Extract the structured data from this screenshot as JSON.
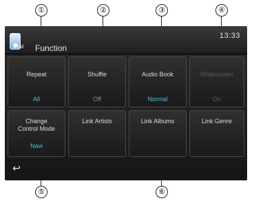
{
  "callouts": [
    "①",
    "②",
    "③",
    "④",
    "⑤",
    "⑥"
  ],
  "header": {
    "ipod_label": "iPod",
    "title": "Function",
    "clock": "13:33"
  },
  "tiles": [
    {
      "label": "Repeat",
      "value": "All"
    },
    {
      "label": "Shuffle",
      "value": "Off"
    },
    {
      "label": "Audio Book",
      "value": "Normal"
    },
    {
      "label": "Widescreen",
      "value": "On"
    },
    {
      "label": "Change\nControl Mode",
      "value": "Navi"
    },
    {
      "label": "Link Artists"
    },
    {
      "label": "Link Albums"
    },
    {
      "label": "Link Genre"
    }
  ],
  "back_icon": "↩",
  "icons": {
    "ipod": "ipod-icon",
    "back": "back-arrow-icon"
  },
  "colors": {
    "accent_value": "#3cc6d8",
    "screen_bg": "#1c1c1c",
    "disabled": "#5a5a5a"
  }
}
